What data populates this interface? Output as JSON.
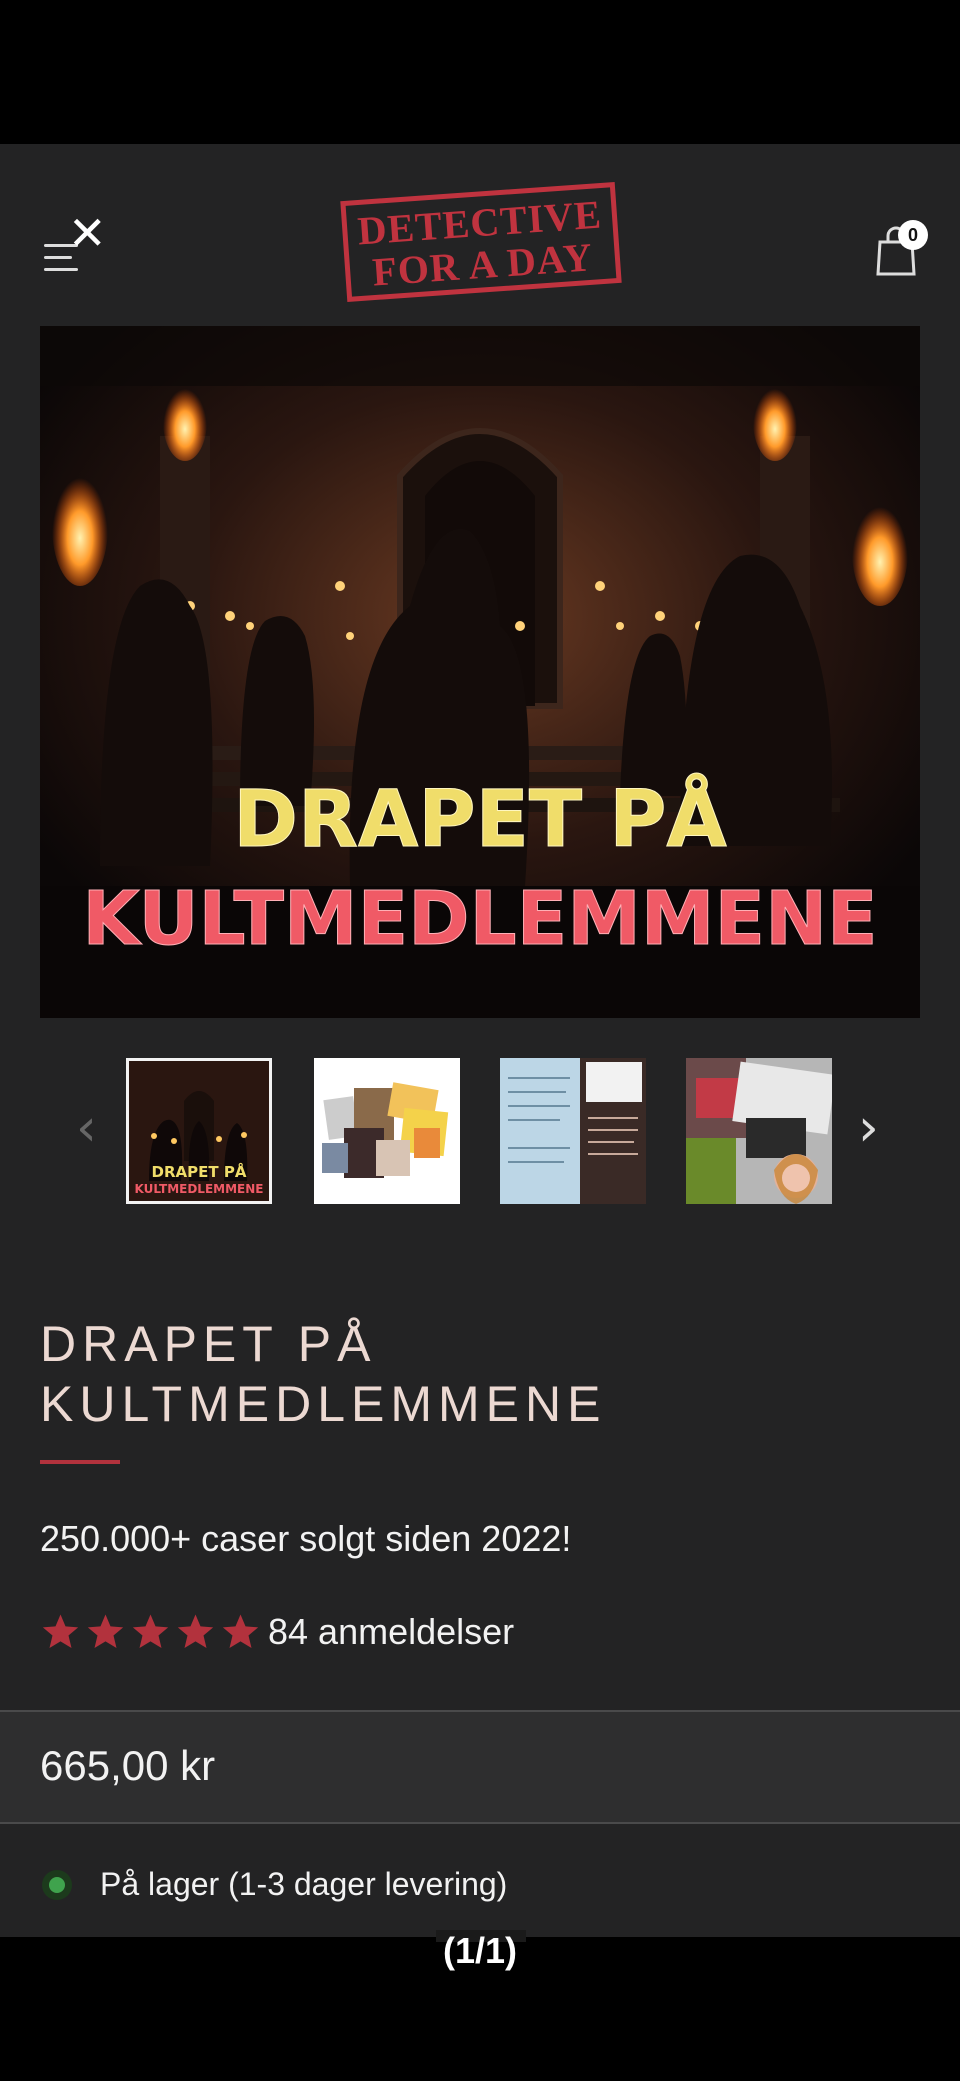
{
  "header": {
    "menu_icon": "menu-close-icon",
    "logo_text_line1": "DETECTIVE",
    "logo_text_line2": "FOR A DAY",
    "cart_icon": "shopping-bag-icon",
    "cart_count": "0"
  },
  "hero": {
    "title_line1": "DRAPET PÅ",
    "title_line2": "KULTMEDLEMMENE"
  },
  "gallery": {
    "prev_icon": "chevron-left-icon",
    "next_icon": "chevron-right-icon",
    "thumbs": [
      {
        "name": "cover",
        "text_line1": "DRAPET PÅ",
        "text_line2": "KULTMEDLEMMENE"
      },
      {
        "name": "case-contents"
      },
      {
        "name": "case-documents"
      },
      {
        "name": "case-photos"
      }
    ]
  },
  "product": {
    "title": "DRAPET PÅ KULTMEDLEMMENE",
    "tagline": "250.000+ caser solgt siden 2022!",
    "rating": 5,
    "rating_max": 5,
    "reviews": "84 anmeldelser",
    "price": "665,00 kr",
    "stock": "På lager (1-3 dager levering)"
  },
  "colors": {
    "background": "#232324",
    "accent": "#b2323d",
    "logo_red": "#c0333f",
    "stock_green": "#3fa34d"
  },
  "pager": "(1/1)"
}
